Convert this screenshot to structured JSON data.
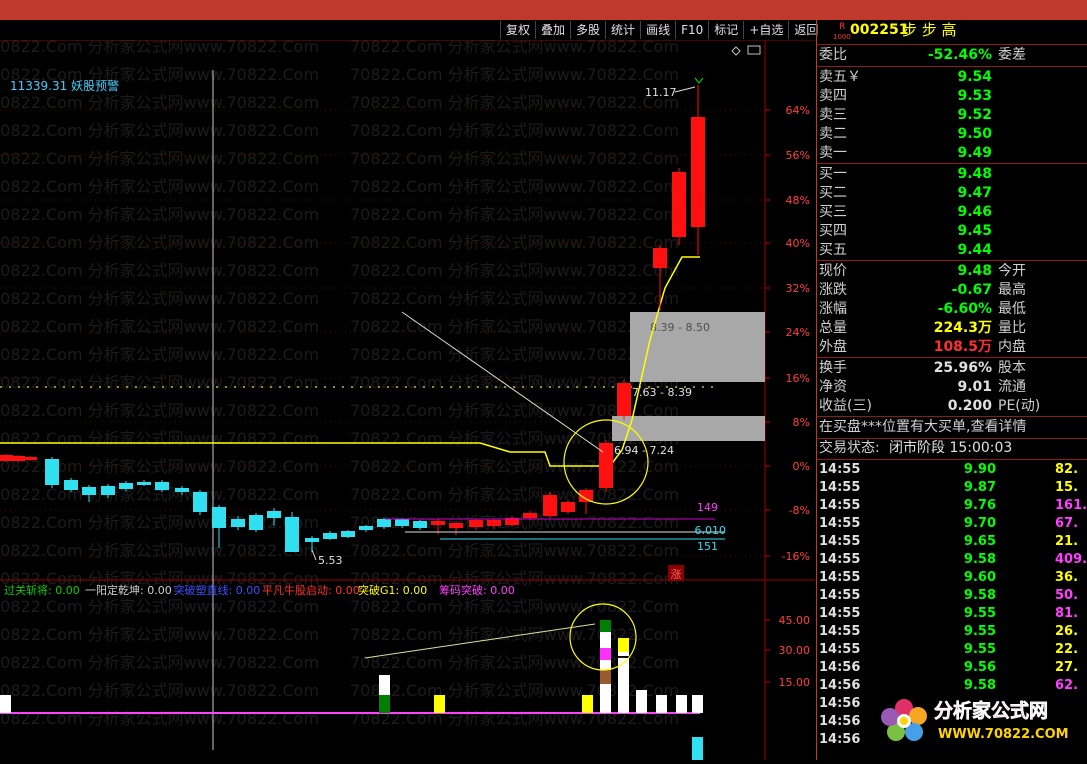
{
  "stock": {
    "marker": "R",
    "marker_sub": "1000",
    "code": "002251",
    "name": "步 步 高"
  },
  "toolbar": [
    "复权",
    "叠加",
    "多股",
    "统计",
    "画线",
    "F10",
    "标记",
    "+自选",
    "返回"
  ],
  "chart": {
    "index_label": "11339.31 妖股预警",
    "watermark": "70822.Com  分析家公式网www.70822.Com",
    "pct_ticks": [
      "64%",
      "56%",
      "48%",
      "40%",
      "32%",
      "24%",
      "16%",
      "8%",
      "0%",
      "-8%",
      "-16%"
    ],
    "annotations": {
      "high": "11.17",
      "low": "5.53",
      "zone_upper": "8.39 - 8.50",
      "zone_mid": "7.63 - 8.39",
      "zone_lower": "6.94 - 7.24",
      "line_149": "149",
      "line_6010": "6.010",
      "line_151": "151",
      "zhang": "涨"
    },
    "indicator": {
      "items": [
        {
          "label": "过关斩将: 0.00",
          "color": "#00d000"
        },
        {
          "label": "一阳定乾坤: 0.00",
          "color": "#d0d0d0"
        },
        {
          "label": "突破塑直线: 0.00",
          "color": "#3a50ff"
        },
        {
          "label": "平凡牛股启动: 0.00",
          "color": "#ff3030"
        },
        {
          "label": "突破G1: 0.00",
          "color": "#ffff00"
        },
        {
          "label": "筹码突破: 0.00",
          "color": "#ff40ff"
        }
      ],
      "ticks": [
        "45.00",
        "30.00",
        "15.00"
      ]
    }
  },
  "panel": {
    "weibi": {
      "label": "委比",
      "value": "-52.46%",
      "label2": "委差"
    },
    "sell": [
      {
        "label": "卖五￥",
        "price": "9.54"
      },
      {
        "label": "卖四",
        "price": "9.53"
      },
      {
        "label": "卖三",
        "price": "9.52"
      },
      {
        "label": "卖二",
        "price": "9.50"
      },
      {
        "label": "卖一",
        "price": "9.49"
      }
    ],
    "buy": [
      {
        "label": "买一",
        "price": "9.48"
      },
      {
        "label": "买二",
        "price": "9.47"
      },
      {
        "label": "买三",
        "price": "9.46"
      },
      {
        "label": "买四",
        "price": "9.45"
      },
      {
        "label": "买五",
        "price": "9.44"
      }
    ],
    "quote": [
      {
        "label": "现价",
        "value": "9.48",
        "label2": "今开",
        "color": "#00ff00"
      },
      {
        "label": "涨跌",
        "value": "-0.67",
        "label2": "最高",
        "color": "#00ff00"
      },
      {
        "label": "涨幅",
        "value": "-6.60%",
        "label2": "最低",
        "color": "#00ff00"
      },
      {
        "label": "总量",
        "value": "224.3万",
        "label2": "量比",
        "color": "#ffff00"
      },
      {
        "label": "外盘",
        "value": "108.5万",
        "label2": "内盘",
        "color": "#ff3030"
      }
    ],
    "fund": [
      {
        "label": "换手",
        "value": "25.96%",
        "label2": "股本"
      },
      {
        "label": "净资",
        "value": "9.01",
        "label2": "流通"
      },
      {
        "label": "收益(三)",
        "value": "0.200",
        "label2": "PE(动)"
      }
    ],
    "notice": "在买盘***位置有大买单,查看详情",
    "trade_state": {
      "label": "交易状态:",
      "value": "闭市阶段 15:00:03"
    },
    "ticks": [
      {
        "time": "14:55",
        "price": "9.90",
        "vol": "82."
      },
      {
        "time": "14:55",
        "price": "9.87",
        "vol": "15."
      },
      {
        "time": "14:55",
        "price": "9.76",
        "vol": "161."
      },
      {
        "time": "14:55",
        "price": "9.70",
        "vol": "67."
      },
      {
        "time": "14:55",
        "price": "9.65",
        "vol": "21."
      },
      {
        "time": "14:55",
        "price": "9.58",
        "vol": "409."
      },
      {
        "time": "14:55",
        "price": "9.60",
        "vol": "36."
      },
      {
        "time": "14:55",
        "price": "9.58",
        "vol": "50."
      },
      {
        "time": "14:55",
        "price": "9.55",
        "vol": "81."
      },
      {
        "time": "14:55",
        "price": "9.55",
        "vol": "26."
      },
      {
        "time": "14:55",
        "price": "9.55",
        "vol": "22."
      },
      {
        "time": "14:56",
        "price": "9.56",
        "vol": "27."
      },
      {
        "time": "14:56",
        "price": "9.58",
        "vol": "62."
      },
      {
        "time": "14:56",
        "price": "",
        "vol": ""
      },
      {
        "time": "14:56",
        "price": "",
        "vol": ""
      },
      {
        "time": "14:56",
        "price": "",
        "vol": ""
      }
    ],
    "tick_vol_colors": [
      "#ffff00",
      "#ffff00",
      "#ff40ff",
      "#ff40ff",
      "#ffff00",
      "#ff40ff",
      "#ffff00",
      "#ff40ff",
      "#ff40ff",
      "#ffff00",
      "#ffff00",
      "#ffff00",
      "#ff40ff"
    ]
  },
  "logo": {
    "name": "分析家公式网",
    "url": "WWW.70822.COM"
  }
}
